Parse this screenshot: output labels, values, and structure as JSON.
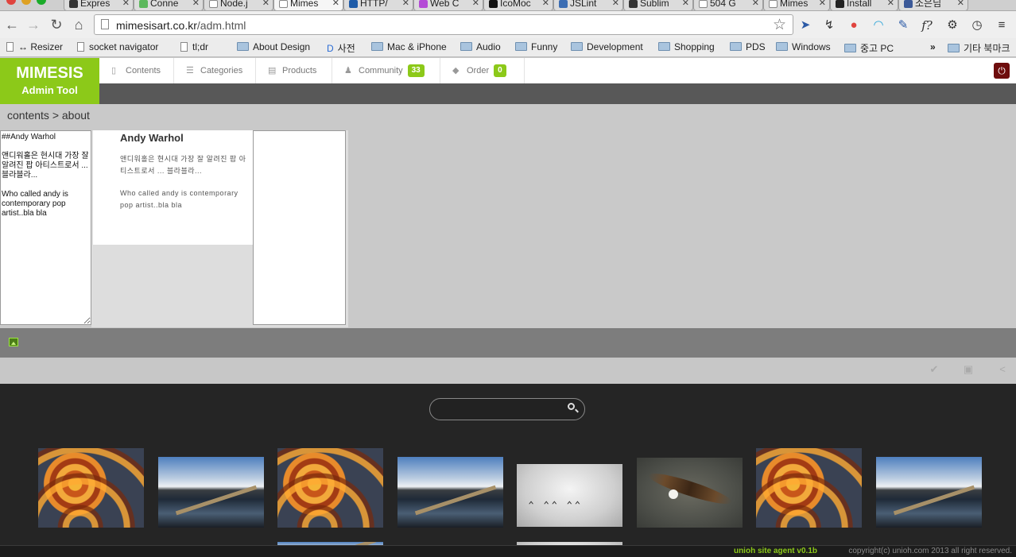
{
  "browser": {
    "tabs": [
      {
        "label": "Expres",
        "color": "#333"
      },
      {
        "label": "Conne",
        "color": "#5cb85c"
      },
      {
        "label": "Node.j",
        "color": "#ffffff"
      },
      {
        "label": "Mimes",
        "color": "#ffffff"
      },
      {
        "label": "HTTP/",
        "color": "#1e5ba8"
      },
      {
        "label": "Web C",
        "color": "#b44bd6"
      },
      {
        "label": "IcoMoc",
        "color": "#111111"
      },
      {
        "label": "JSLint",
        "color": "#3b6db3"
      },
      {
        "label": "Sublim",
        "color": "#333333"
      },
      {
        "label": "504 G",
        "color": "#ffffff"
      },
      {
        "label": "Mimes",
        "color": "#ffffff"
      },
      {
        "label": "Install",
        "color": "#222222"
      },
      {
        "label": "소은님",
        "color": "#3b5998"
      }
    ],
    "url_host": "mimesisart.co.kr",
    "url_path": "/adm.html",
    "bookmarks": [
      {
        "label": "↔ Resizer",
        "kind": "plain"
      },
      {
        "label": "socket navigator",
        "kind": "doc"
      },
      {
        "label": "tl;dr",
        "kind": "doc"
      },
      {
        "label": "About Design",
        "kind": "folder"
      },
      {
        "label": "사전",
        "kind": "plain"
      },
      {
        "label": "Mac & iPhone",
        "kind": "folder"
      },
      {
        "label": "Audio",
        "kind": "folder"
      },
      {
        "label": "Funny",
        "kind": "folder"
      },
      {
        "label": "Development",
        "kind": "folder"
      },
      {
        "label": "Shopping",
        "kind": "folder"
      },
      {
        "label": "PDS",
        "kind": "folder"
      },
      {
        "label": "Windows",
        "kind": "folder"
      },
      {
        "label": "중고 PC",
        "kind": "folder"
      },
      {
        "label": "»",
        "kind": "plain"
      },
      {
        "label": "기타 북마크",
        "kind": "folder"
      }
    ]
  },
  "app": {
    "logo_line1": "MIMESIS",
    "logo_line2": "Admin Tool",
    "menu": [
      {
        "label": "Contents",
        "icon": "document-icon",
        "badge": ""
      },
      {
        "label": "Categories",
        "icon": "list-icon",
        "badge": ""
      },
      {
        "label": "Products",
        "icon": "box-icon",
        "badge": ""
      },
      {
        "label": "Community",
        "icon": "person-icon",
        "badge": "33"
      },
      {
        "label": "Order",
        "icon": "tag-icon",
        "badge": "0"
      }
    ],
    "breadcrumb": "contents > about",
    "editor_text": "##Andy Warhol\n\n앤디워홀은 현시대 가장 잘 알려진 팝 아티스트로서 ... 블라블라...\n\nWho called andy is contemporary pop artist..bla bla",
    "preview": {
      "title": "Andy Warhol",
      "para1": "앤디워홀은 현시대 가장 잘 알려진 팝 아티스트로서 ... 블라블라...",
      "para2": "Who called andy is contemporary pop artist..bla bla"
    },
    "gallery_images": [
      "rope",
      "lake",
      "rope",
      "lake",
      "geese",
      "eagle",
      "rope",
      "lake",
      "lake",
      "geese"
    ],
    "footer_agent": "unioh site agent v0.1b",
    "footer_copyright": "copyright(c) unioh.com 2013 all right reserved.",
    "accent_color": "#8cc919"
  }
}
